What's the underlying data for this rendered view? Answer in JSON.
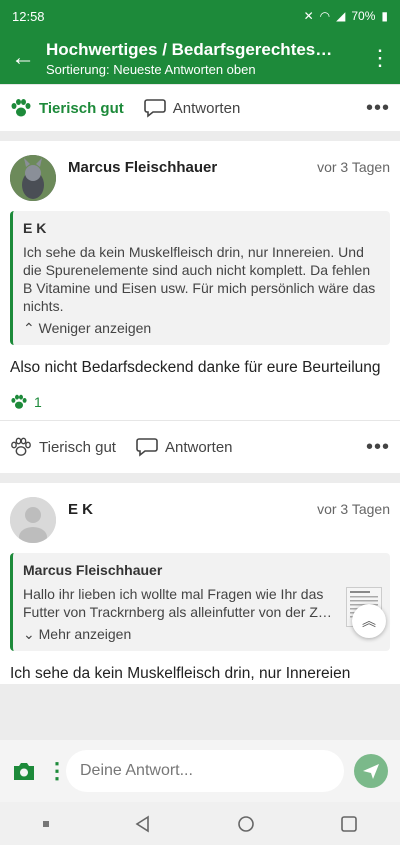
{
  "status": {
    "time": "12:58",
    "battery": "70%"
  },
  "header": {
    "title": "Hochwertiges / Bedarfsgerechtes…",
    "subtitle": "Sortierung: Neueste Antworten oben"
  },
  "top_actions": {
    "like_label": "Tierisch gut",
    "reply_label": "Antworten"
  },
  "post1": {
    "author": "Marcus Fleischhauer",
    "time": "vor 3 Tagen",
    "quote_author": "E K",
    "quote_text": "Ich sehe da kein Muskelfleisch drin, nur Innereien. Und die Spurenelemente sind auch nicht komplett. Da fehlen B Vitamine und Eisen usw. Für mich persönlich wäre das nichts.",
    "quote_toggle": "Weniger anzeigen",
    "text": "Also nicht Bedarfsdeckend danke für eure Beurteilung",
    "likes": "1",
    "like_label": "Tierisch gut",
    "reply_label": "Antworten"
  },
  "post2": {
    "author": "E K",
    "time": "vor 3 Tagen",
    "quote_author": "Marcus Fleischhauer",
    "quote_text": "Hallo ihr lieben ich wollte mal Fragen wie Ihr das Futter von Trackrnberg als alleinfutter von der Z…",
    "quote_toggle": "Mehr anzeigen",
    "text": "Ich sehe da kein Muskelfleisch drin, nur Innereien"
  },
  "composer": {
    "placeholder": "Deine Antwort..."
  }
}
